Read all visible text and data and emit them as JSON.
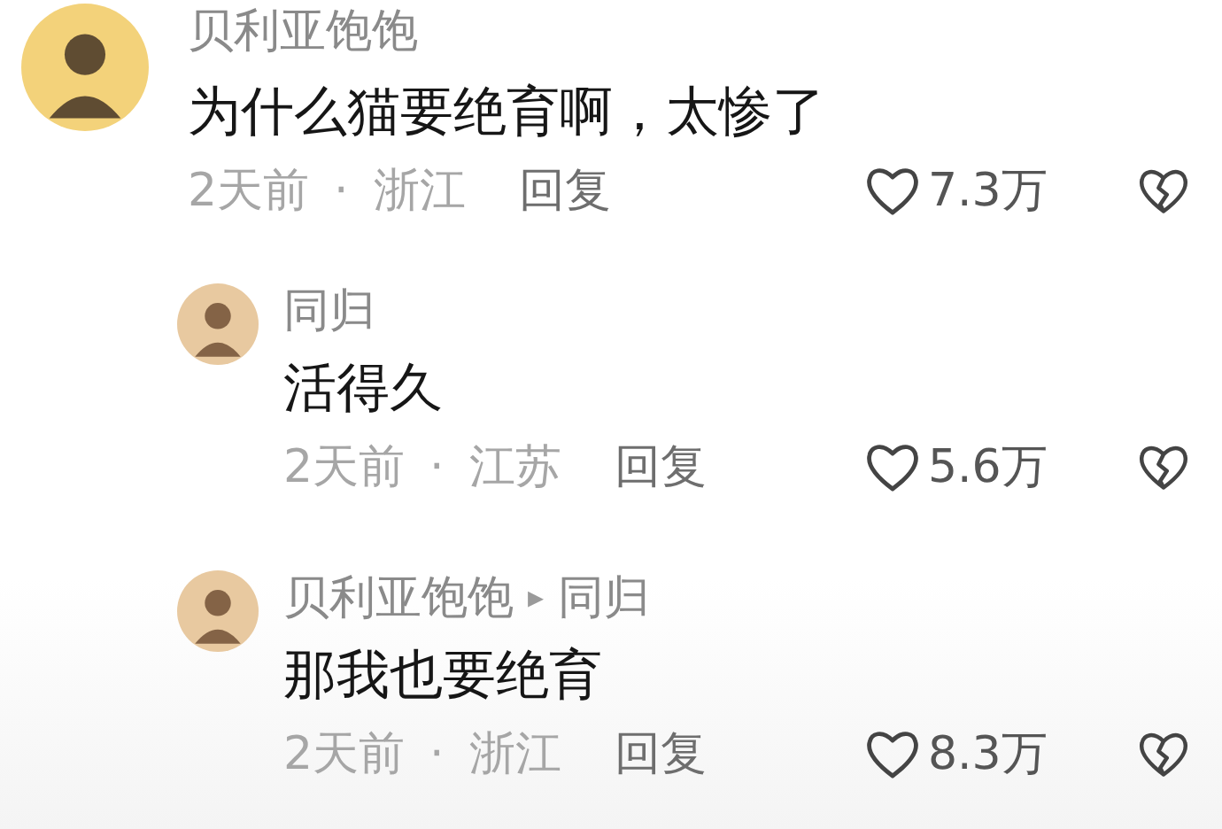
{
  "comments": [
    {
      "kind": "top",
      "author": "贝利亚饱饱",
      "text": "为什么猫要绝育啊，太惨了",
      "time": "2天前",
      "separator": "·",
      "location": "浙江",
      "reply_label": "回复",
      "likes": "7.3万"
    },
    {
      "kind": "reply",
      "author": "同归",
      "text": "活得久",
      "time": "2天前",
      "separator": "·",
      "location": "江苏",
      "reply_label": "回复",
      "likes": "5.6万"
    },
    {
      "kind": "reply",
      "author": "贝利亚饱饱",
      "reply_arrow": "▸",
      "reply_to": "同归",
      "text": "那我也要绝育",
      "time": "2天前",
      "separator": "·",
      "location": "浙江",
      "reply_label": "回复",
      "likes": "8.3万"
    }
  ]
}
